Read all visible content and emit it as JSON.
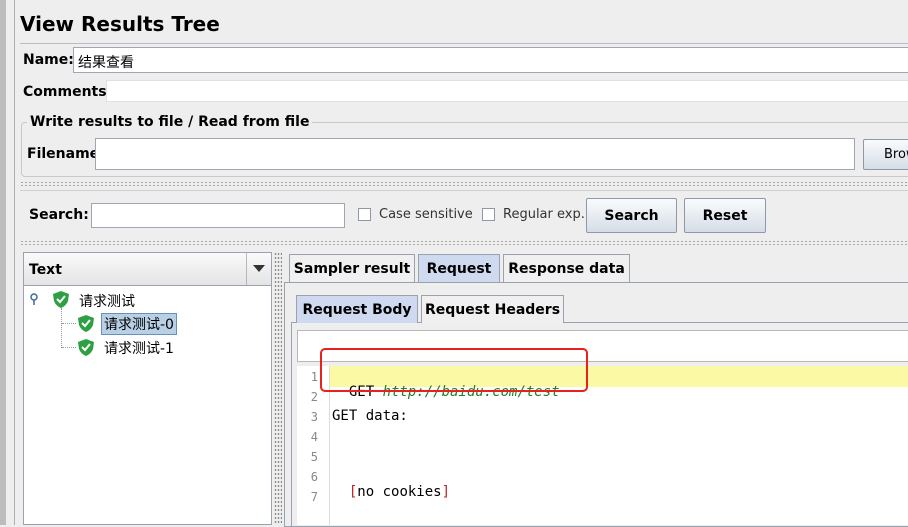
{
  "window": {
    "title": "View Results Tree"
  },
  "form": {
    "name_label": "Name:",
    "name_value": "结果查看",
    "comments_label": "Comments:",
    "comments_value": ""
  },
  "file_section": {
    "title": "Write results to file / Read from file",
    "filename_label": "Filename",
    "filename_value": "",
    "browse_label": "Brow"
  },
  "search": {
    "label": "Search:",
    "value": "",
    "case_sensitive_label": "Case sensitive",
    "case_sensitive_checked": false,
    "regex_label": "Regular exp.",
    "regex_checked": false,
    "search_button": "Search",
    "reset_button": "Reset"
  },
  "tree": {
    "renderer_selected": "Text",
    "root": {
      "label": "请求测试",
      "status": "success"
    },
    "children": [
      {
        "label": "请求测试-0",
        "status": "success",
        "selected": true
      },
      {
        "label": "请求测试-1",
        "status": "success",
        "selected": false
      }
    ]
  },
  "tabs": {
    "main": [
      "Sampler result",
      "Request",
      "Response data"
    ],
    "main_selected": "Request",
    "sub": [
      "Request Body",
      "Request Headers"
    ],
    "sub_selected": "Request Body"
  },
  "editor": {
    "lines": [
      {
        "num": "1",
        "text_plain": "GET ",
        "text_link": "http://baidu.com/test",
        "highlighted": true
      },
      {
        "num": "2",
        "text_plain": ""
      },
      {
        "num": "3",
        "text_plain": "GET data:"
      },
      {
        "num": "4",
        "text_plain": ""
      },
      {
        "num": "5",
        "text_plain": ""
      },
      {
        "num": "6",
        "bracket_open": "[",
        "text_plain": "no cookies",
        "bracket_close": "]"
      },
      {
        "num": "7",
        "text_plain": ""
      }
    ]
  },
  "colors": {
    "annotation_box": "#e8211c",
    "line_highlight": "#fbf9a4",
    "tab_selected": "#cfdaf0",
    "success_shield": "#2ea043"
  }
}
